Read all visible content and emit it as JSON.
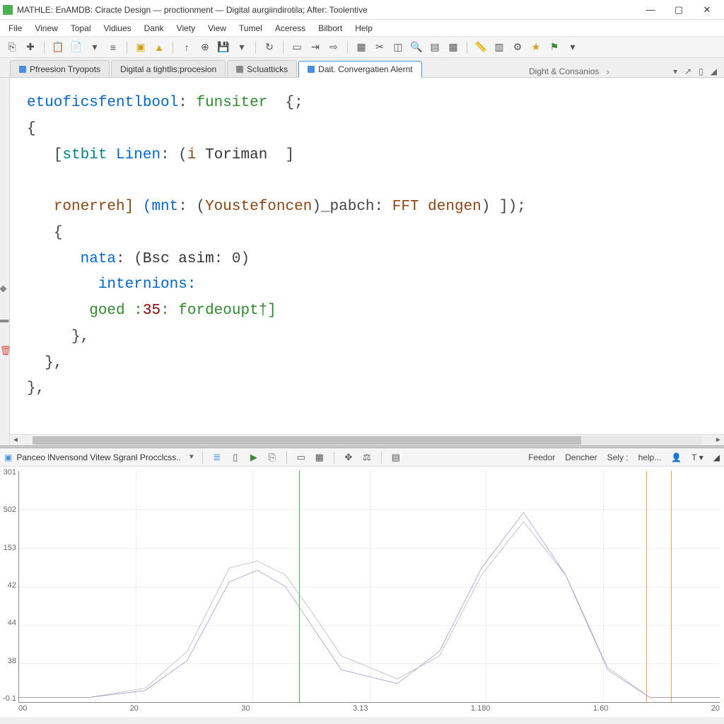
{
  "title": "MATHLE: EnAMDB: Ciracte Design — proctionment — Digital aurgiindirotila; After: Toolentive",
  "menu": [
    "File",
    "Vinew",
    "Topal",
    "Vidiues",
    "Dank",
    "Viety",
    "View",
    "Tumel",
    "Aceress",
    "Bilbort",
    "Help"
  ],
  "tabs": [
    {
      "label": "Pfreesion Tryopots",
      "active": false
    },
    {
      "label": "Digital a tightlis;procesion",
      "active": false
    },
    {
      "label": "ScIuatticks",
      "active": false
    },
    {
      "label": "Dait. Convergatien Alernt",
      "active": true
    }
  ],
  "breadcrumb": "Dight & Consanios",
  "code": {
    "l1a": "etuoficsfentlbool",
    "l1b": "funsiter",
    "l1c": "{;",
    "l2": "{",
    "l3a": "[",
    "l3b": "stbit",
    "l3c": "Linen",
    "l3d": ": (",
    "l3e": "i",
    "l3f": "Toriman",
    "l3g": "]",
    "l4a": "ronerreh]",
    "l4b": "(mnt",
    "l4c": ": (",
    "l4d": "Youstefoncen",
    "l4e": ")_pabch:",
    "l4f": "FFT",
    "l4g": "dengen",
    "l4h": ") ]);",
    "l5": "{",
    "l6a": "nata",
    "l6b": ": (",
    "l6c": "Bsc",
    "l6d": "asim",
    "l6e": ": 0)",
    "l7": "internions:",
    "l8a": "goed :",
    "l8b": "35",
    "l8c": ": fordeoupt†]",
    "l9": "},",
    "l10": "},",
    "l11": "},"
  },
  "panel": {
    "title": "Panceo lNvensond Vitew Sgranl Procclcss..",
    "right": [
      "Feedor",
      "Dencher",
      "Sely :",
      "help..."
    ]
  },
  "chart_data": {
    "type": "line",
    "ylabel": "",
    "xlabel": "",
    "yticks": [
      "301",
      "502",
      "153",
      "42",
      "44",
      "38",
      "-0.1"
    ],
    "xticks": [
      "00",
      "20",
      "30",
      "3.13",
      "1.180",
      "1.60",
      "20"
    ],
    "cursors": {
      "green": 0.4,
      "orange1": 0.895,
      "orange2": 0.93
    },
    "series": [
      {
        "name": "gray",
        "color": "#9aa5ad",
        "x": [
          0.0,
          0.1,
          0.18,
          0.24,
          0.3,
          0.34,
          0.38,
          0.42,
          0.46,
          0.54,
          0.6,
          0.66,
          0.72,
          0.78,
          0.84,
          0.9,
          1.0
        ],
        "y": [
          0.02,
          0.02,
          0.06,
          0.22,
          0.58,
          0.61,
          0.55,
          0.38,
          0.2,
          0.1,
          0.2,
          0.55,
          0.78,
          0.55,
          0.15,
          0.02,
          0.02
        ]
      },
      {
        "name": "purple",
        "color": "#8a7fbf",
        "x": [
          0.0,
          0.1,
          0.18,
          0.24,
          0.3,
          0.34,
          0.38,
          0.42,
          0.46,
          0.54,
          0.6,
          0.66,
          0.72,
          0.78,
          0.84,
          0.9,
          1.0
        ],
        "y": [
          0.02,
          0.02,
          0.05,
          0.18,
          0.52,
          0.57,
          0.5,
          0.32,
          0.14,
          0.08,
          0.22,
          0.58,
          0.82,
          0.55,
          0.14,
          0.02,
          0.02
        ]
      }
    ]
  }
}
